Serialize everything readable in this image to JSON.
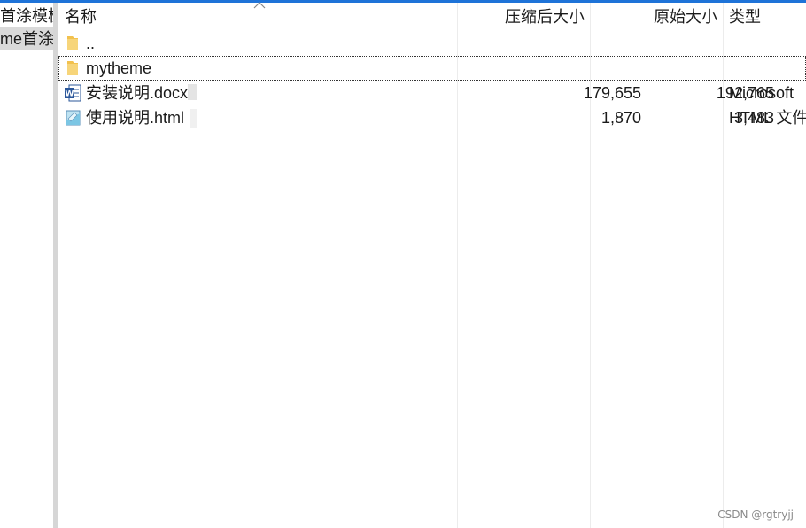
{
  "tree": {
    "items": [
      {
        "label": "首涂模板"
      },
      {
        "label": "me首涂"
      }
    ]
  },
  "columns": {
    "name": "名称",
    "compressed": "压缩后大小",
    "original": "原始大小",
    "type": "类型"
  },
  "rows": [
    {
      "icon": "folder-up-icon",
      "name": "..",
      "compressed": "",
      "original": "",
      "type": ""
    },
    {
      "icon": "folder-icon",
      "name": "mytheme",
      "compressed": "",
      "original": "",
      "type": ""
    },
    {
      "icon": "word-document-icon",
      "name": "安装说明.docx",
      "compressed": "179,655",
      "original": "192,765",
      "type": "Microsoft"
    },
    {
      "icon": "html-file-icon",
      "name": "使用说明.html",
      "compressed": "1,870",
      "original": "3,483",
      "type": "HTML 文件"
    }
  ],
  "watermark": "CSDN @rgtryjj",
  "colors": {
    "accent": "#1e73d8",
    "folder": "#f2c14e",
    "word": "#2b579a"
  }
}
